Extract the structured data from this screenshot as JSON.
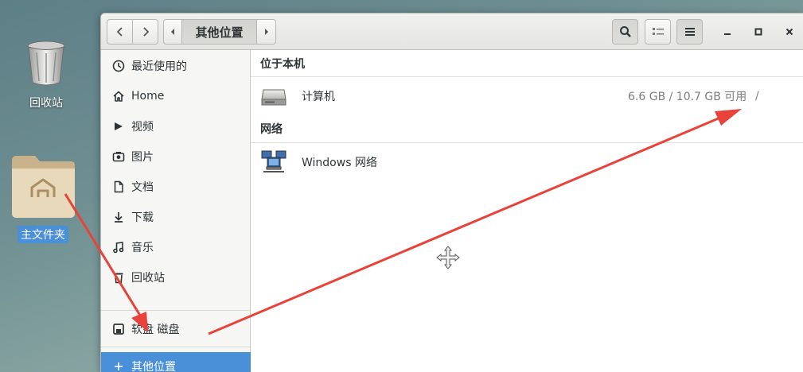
{
  "desktop": {
    "trash_label": "回收站",
    "home_label": "主文件夹"
  },
  "headerbar": {
    "back_icon": "go-back-icon",
    "forward_icon": "go-forward-icon",
    "path_current": "其他位置",
    "search_icon": "search-icon",
    "view_icon": "list-view-icon",
    "menu_icon": "hamburger-menu-icon"
  },
  "sidebar": {
    "items": [
      {
        "label": "最近使用的",
        "icon": "clock-icon"
      },
      {
        "label": "Home",
        "icon": "home-icon"
      },
      {
        "label": "视频",
        "icon": "video-icon"
      },
      {
        "label": "图片",
        "icon": "camera-icon"
      },
      {
        "label": "文档",
        "icon": "document-icon"
      },
      {
        "label": "下载",
        "icon": "download-icon"
      },
      {
        "label": "音乐",
        "icon": "music-icon"
      },
      {
        "label": "回收站",
        "icon": "trash-icon"
      },
      {
        "label": "软盘  磁盘",
        "icon": "floppy-icon"
      },
      {
        "label": "其他位置",
        "icon": "plus-icon"
      }
    ]
  },
  "main": {
    "section_local": "位于本机",
    "computer": {
      "name": "计算机",
      "capacity": "6.6 GB / 10.7 GB 可用",
      "mount": "/"
    },
    "section_network": "网络",
    "network": {
      "name": "Windows 网络"
    }
  },
  "colors": {
    "accent": "#4a90d9",
    "annotation_arrow": "#e8423a"
  }
}
